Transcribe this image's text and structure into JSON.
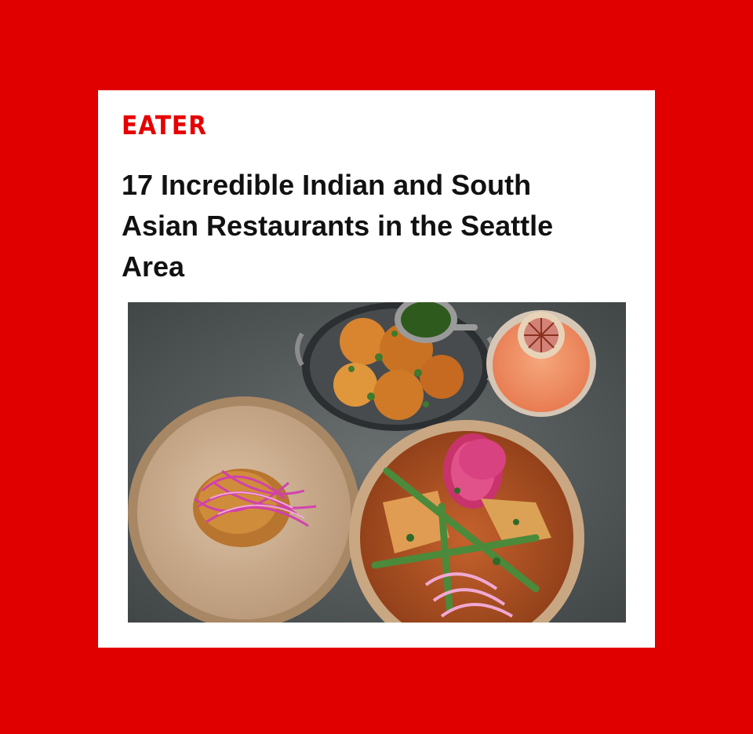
{
  "brand": {
    "name": "EATER",
    "color": "#e60000"
  },
  "article": {
    "title": "17 Incredible Indian and South Asian Restaurants in the Seattle Area"
  },
  "photo": {
    "subject": [
      "plate-with-fritter",
      "pakora-bowl",
      "chutney-cup",
      "cocktail-glass",
      "curry-bowl"
    ]
  },
  "colors": {
    "background": "#e00000",
    "card": "#ffffff"
  }
}
